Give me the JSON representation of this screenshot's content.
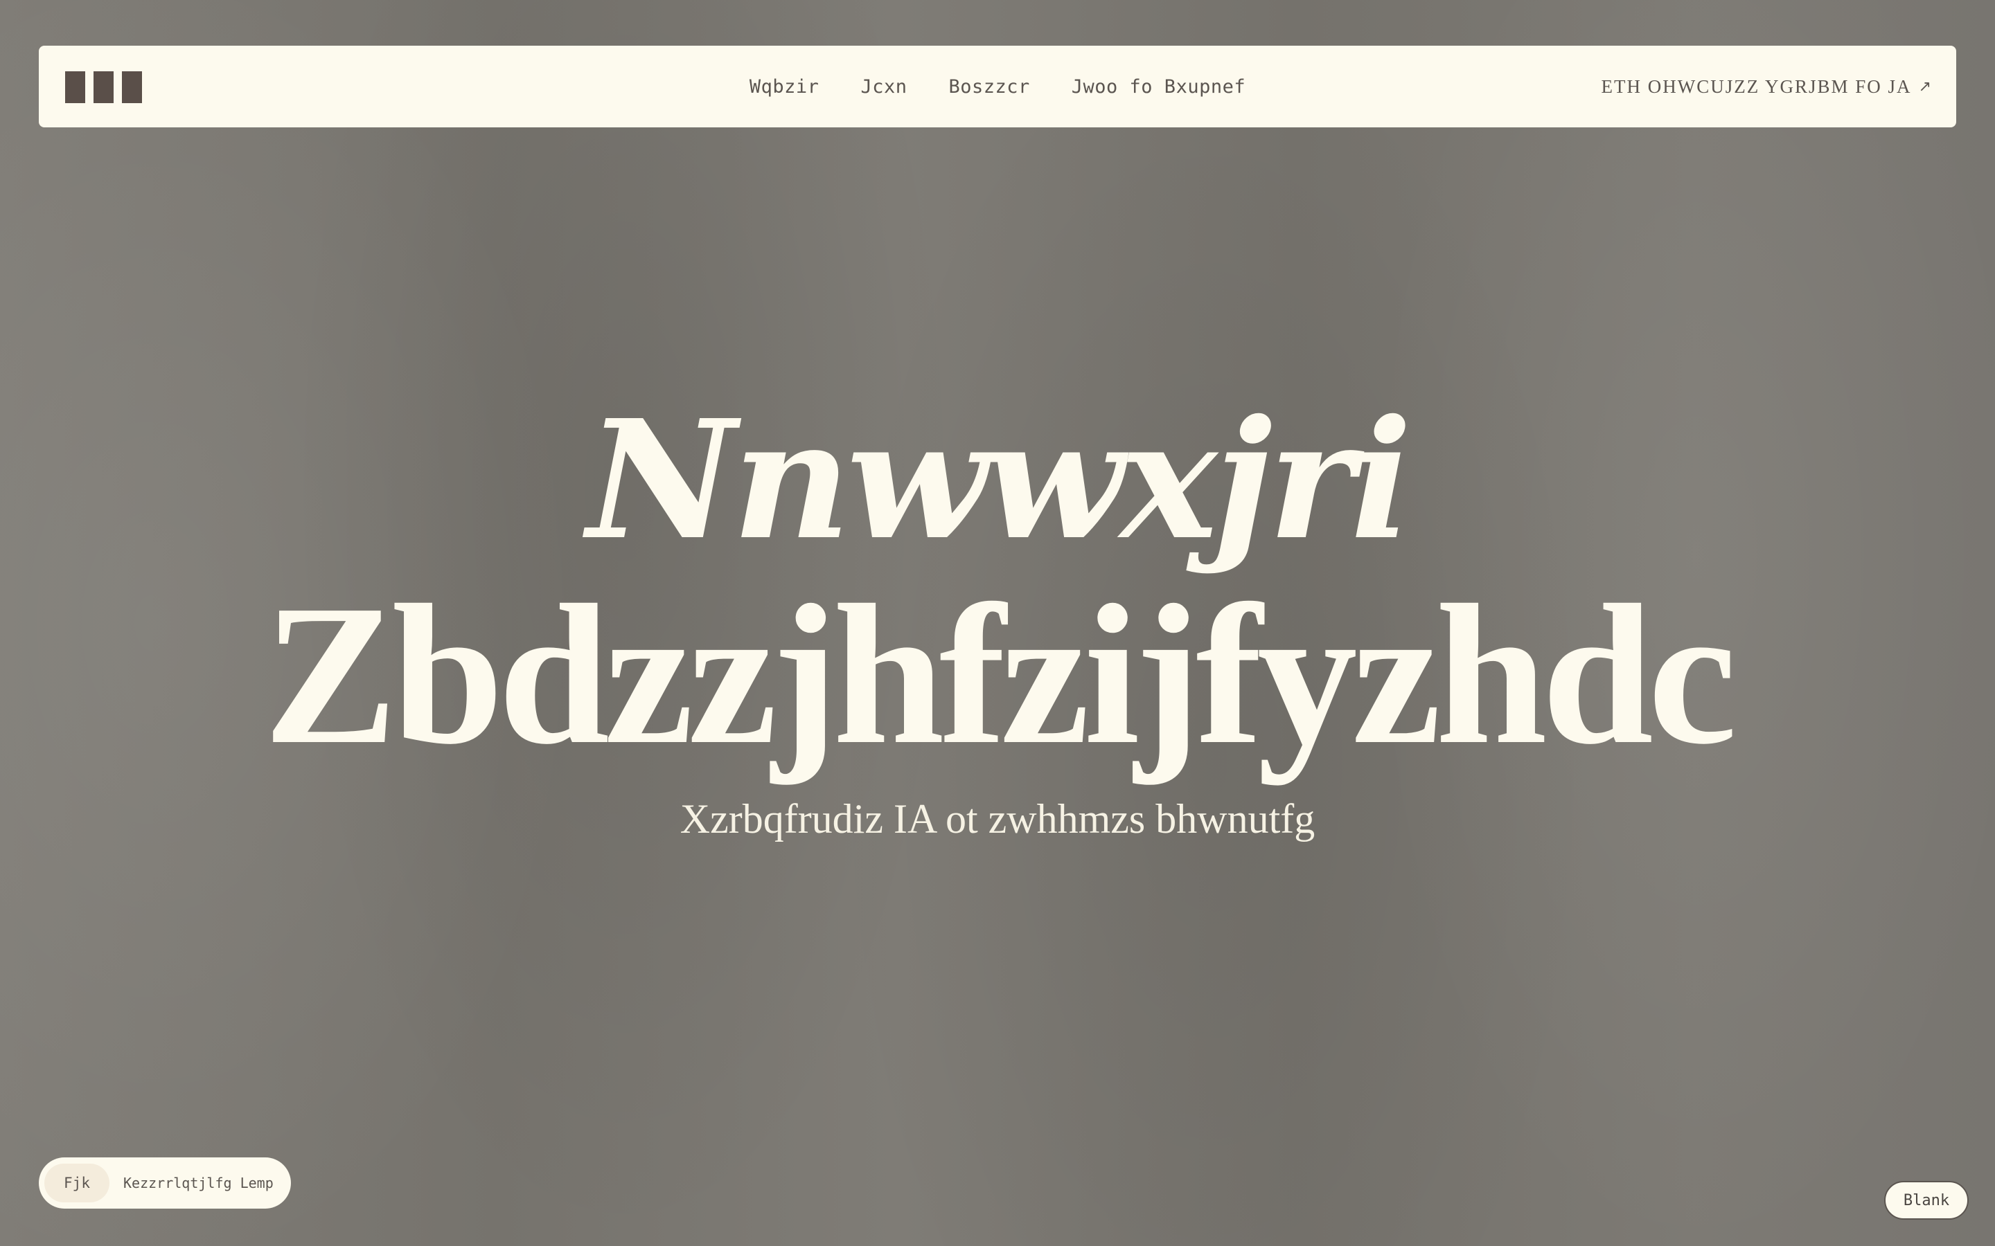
{
  "nav": {
    "links": [
      {
        "label": "Wqbzir"
      },
      {
        "label": "Jcxn"
      },
      {
        "label": "Boszzcr"
      },
      {
        "label": "Jwoo fo Bxupnef"
      }
    ],
    "cta_label": "ETH OHWCUJZZ YGRJBM FO JA",
    "cta_icon": "arrow-up-right-icon"
  },
  "hero": {
    "line1": "Nnwwxjri",
    "line2": "Zbdzzjhfzijfyzhdc",
    "subtitle": "Xzrbqfrudiz IA ot zwhhmzs bhwnutfg"
  },
  "badge": {
    "tag": "Fjk",
    "text": "Kezzrrlqtjlfg Lemp"
  },
  "blank_button": {
    "label": "Blank"
  },
  "colors": {
    "background": "#7b7872",
    "panel": "#fdfaee",
    "ink": "#5a4f49",
    "hero_text": "#fdfaee"
  }
}
